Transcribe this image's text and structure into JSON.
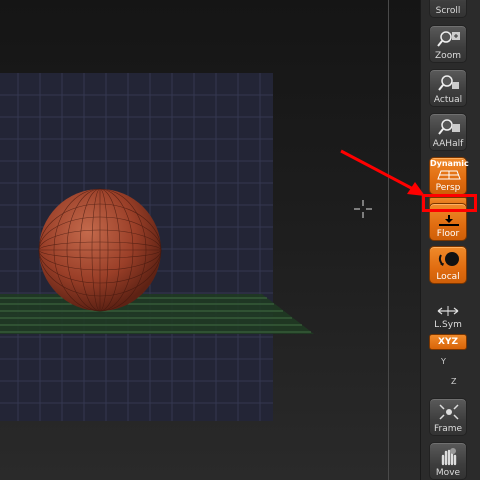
{
  "toolbar": {
    "scroll_label": "Scroll",
    "zoom_label": "Zoom",
    "actual_label": "Actual",
    "aahalf_label": "AAHalf",
    "dynamic_label": "Dynamic",
    "persp_label": "Persp",
    "floor_label": "Floor",
    "local_label": "Local",
    "lsym_label": "L.Sym",
    "xyz_label": "XYZ",
    "y_label": "Y",
    "z_label": "Z",
    "frame_label": "Frame",
    "move_label": "Move"
  },
  "colors": {
    "accent_orange": "#e8761a",
    "highlight_red": "#ff0000",
    "sphere": "#a24a30",
    "floor_grid": "#4a7a4a"
  }
}
